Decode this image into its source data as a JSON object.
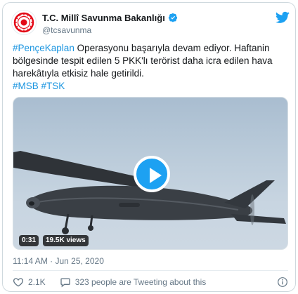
{
  "account": {
    "display_name": "T.C. Millî Savunma Bakanlığı",
    "handle": "@tcsavunma",
    "verified": true,
    "avatar": "crest-logo"
  },
  "tweet": {
    "hashtag_main": "#PençeKaplan",
    "text_after_hashtag": " Operasyonu başarıyla devam ediyor. Haftanin",
    "line2": "bölgesinde tespit edilen 5 PKK'lı terörist daha icra edilen hava",
    "line3": "harekâtıyla etkisiz hale getirildi.",
    "hashtag_1": "#MSB",
    "hashtag_2": "#TSK"
  },
  "media": {
    "type": "video",
    "duration": "0:31",
    "views": "19.5K views",
    "icon": "play-icon"
  },
  "timestamp": "11:14 AM · Jun 25, 2020",
  "footer": {
    "like_count": "2.1K",
    "people_text": "323 people are Tweeting about this"
  },
  "icons": {
    "brand": "twitter-bird-icon",
    "verified": "verified-badge-icon",
    "like": "heart-icon",
    "people": "speech-bubble-icon",
    "info": "info-icon"
  },
  "colors": {
    "accent": "#1da1f2",
    "link": "#1b95e0",
    "secondary_text": "#657786",
    "logo_red": "#e30a17"
  }
}
